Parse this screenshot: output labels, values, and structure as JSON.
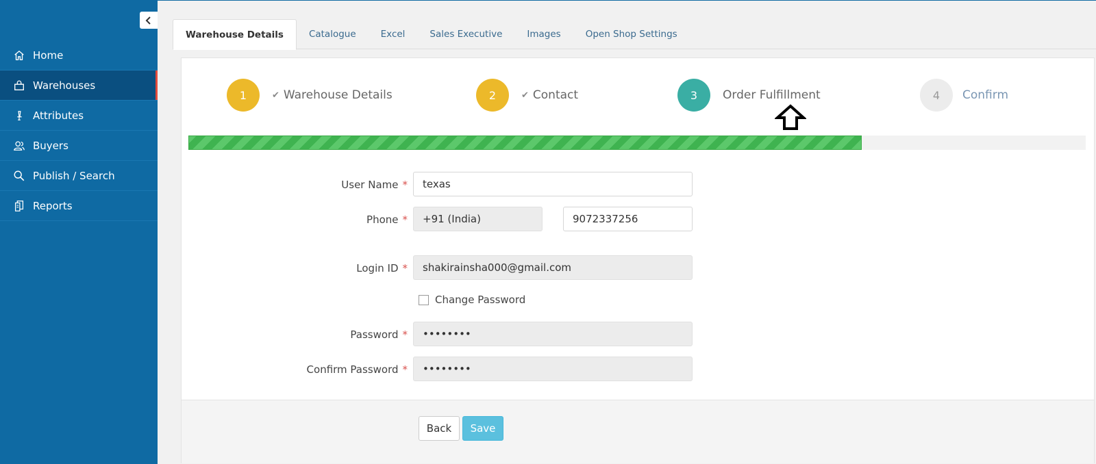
{
  "sidebar": {
    "items": [
      {
        "label": "Home",
        "icon": "home-icon",
        "active": false
      },
      {
        "label": "Warehouses",
        "icon": "shopping-bag-icon",
        "active": true
      },
      {
        "label": "Attributes",
        "icon": "pencil-icon",
        "active": false
      },
      {
        "label": "Buyers",
        "icon": "users-icon",
        "active": false
      },
      {
        "label": "Publish / Search",
        "icon": "search-icon",
        "active": false
      },
      {
        "label": "Reports",
        "icon": "documents-icon",
        "active": false
      }
    ]
  },
  "tabs": [
    {
      "label": "Warehouse Details",
      "active": true
    },
    {
      "label": "Catalogue",
      "active": false
    },
    {
      "label": "Excel",
      "active": false
    },
    {
      "label": "Sales Executive",
      "active": false
    },
    {
      "label": "Images",
      "active": false
    },
    {
      "label": "Open Shop Settings",
      "active": false
    }
  ],
  "steps": [
    {
      "number": "1",
      "label": "Warehouse Details",
      "state": "done"
    },
    {
      "number": "2",
      "label": "Contact",
      "state": "done"
    },
    {
      "number": "3",
      "label": "Order Fulfillment",
      "state": "current"
    },
    {
      "number": "4",
      "label": "Confirm",
      "state": "todo"
    }
  ],
  "progress": {
    "percent": 75
  },
  "form": {
    "user_name": {
      "label": "User Name",
      "value": "texas"
    },
    "phone": {
      "label": "Phone",
      "country": "+91 (India)",
      "number": "9072337256"
    },
    "login_id": {
      "label": "Login ID",
      "value": "shakirainsha000@gmail.com"
    },
    "change_password": {
      "label": "Change Password",
      "checked": false
    },
    "password": {
      "label": "Password",
      "value": "••••••••"
    },
    "confirm_password": {
      "label": "Confirm Password",
      "value": "••••••••"
    },
    "required_mark": "*"
  },
  "buttons": {
    "back": "Back",
    "save": "Save"
  },
  "colors": {
    "sidebar": "#0f6aa3",
    "active_nav": "#0a4f80",
    "step_done": "#ecb92a",
    "step_current": "#3aaea4",
    "progress": "#5cc86b",
    "save": "#5bc0de"
  }
}
